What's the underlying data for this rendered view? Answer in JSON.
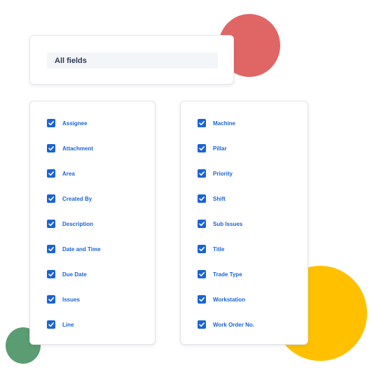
{
  "colors": {
    "accent": "#1a63d6",
    "circle_red": "#e06666",
    "circle_yellow": "#ffc000",
    "circle_green": "#5a9d72"
  },
  "fields_selector": {
    "label": "All fields"
  },
  "left_list": {
    "items": [
      {
        "label": "Assignee",
        "checked": true
      },
      {
        "label": "Attachment",
        "checked": true
      },
      {
        "label": "Area",
        "checked": true
      },
      {
        "label": "Created By",
        "checked": true
      },
      {
        "label": "Description",
        "checked": true
      },
      {
        "label": "Date and Time",
        "checked": true
      },
      {
        "label": "Due Date",
        "checked": true
      },
      {
        "label": "Issues",
        "checked": true
      },
      {
        "label": "Line",
        "checked": true
      }
    ]
  },
  "right_list": {
    "items": [
      {
        "label": "Machine",
        "checked": true
      },
      {
        "label": "Pillar",
        "checked": true
      },
      {
        "label": "Priority",
        "checked": true
      },
      {
        "label": "Shift",
        "checked": true
      },
      {
        "label": "Sub Issues",
        "checked": true
      },
      {
        "label": "Title",
        "checked": true
      },
      {
        "label": "Trade Type",
        "checked": true
      },
      {
        "label": "Workstation",
        "checked": true
      },
      {
        "label": "Work Order No.",
        "checked": true
      }
    ]
  }
}
